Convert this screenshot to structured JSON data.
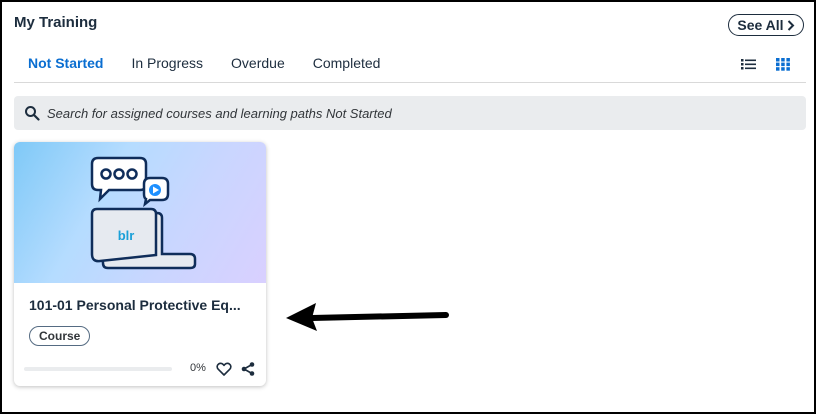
{
  "widget": {
    "title": "My Training",
    "see_all": "See All"
  },
  "tabs": [
    {
      "label": "Not Started",
      "active": true
    },
    {
      "label": "In Progress",
      "active": false
    },
    {
      "label": "Overdue",
      "active": false
    },
    {
      "label": "Completed",
      "active": false
    }
  ],
  "view_toggle": {
    "list_icon": "list-view-icon",
    "grid_icon": "grid-view-icon",
    "selected": "grid"
  },
  "search": {
    "placeholder": "Search for assigned courses and learning paths Not Started"
  },
  "cards": [
    {
      "title": "101-01 Personal Protective Eq...",
      "badge": "Course",
      "progress_label": "0%",
      "progress": 0,
      "thumbnail_text": "blr"
    }
  ],
  "colors": {
    "accent": "#0a6ed1",
    "text": "#1d2d3e",
    "search_bg": "#eaecee"
  }
}
